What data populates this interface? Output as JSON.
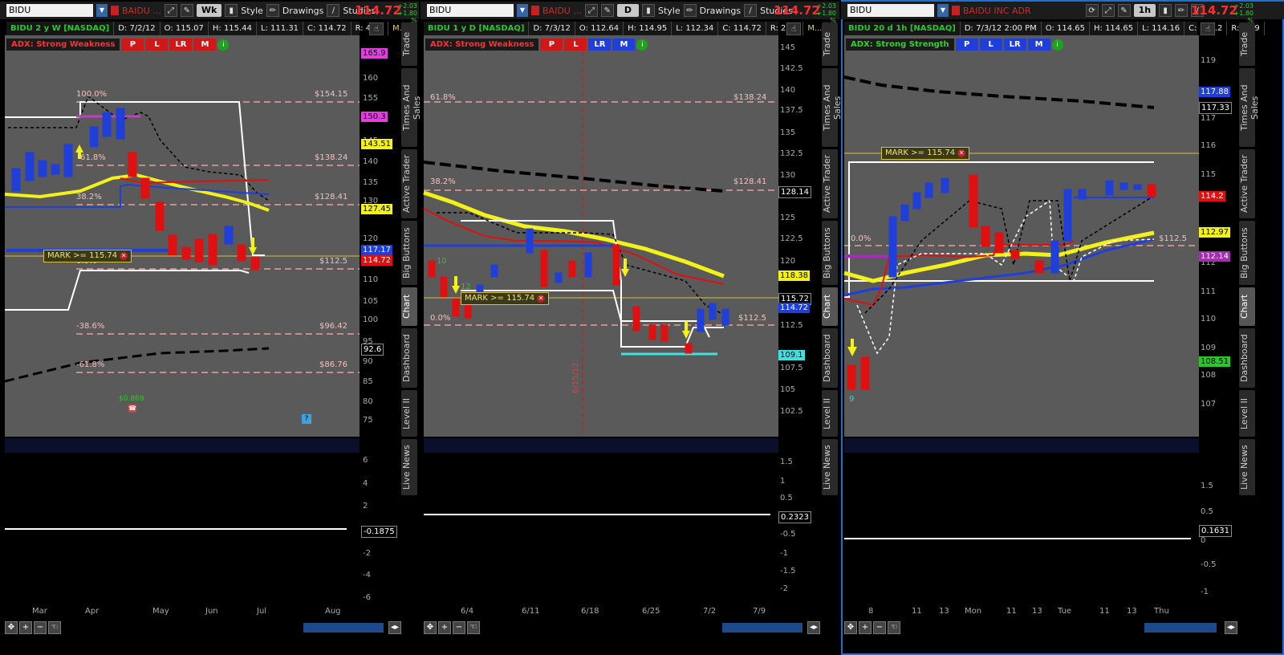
{
  "panels": [
    {
      "symbol": "BIDU",
      "company": "BAIDU ...",
      "period": "Wk",
      "style_label": "Style",
      "drawings_label": "Drawings",
      "studies_label": "Studies",
      "last_price": "114.72",
      "change": "+2.03",
      "change_pct": "+1.80 %",
      "info": [
        "BIDU 2 y W [NASDAQ]",
        "D: 7/2/12",
        "O: 115.07",
        "H: 115.44",
        "L: 111.31",
        "C: 114.72",
        "R: 4.13",
        "M..."
      ],
      "adx_label": "ADX:  Strong Weakness",
      "buttons": [
        "P",
        "L",
        "LR",
        "M"
      ],
      "x_labels": [
        "Mar",
        "Apr",
        "May",
        "Jun",
        "Jul",
        "Aug"
      ],
      "y_labels": [
        "160",
        "155",
        "150",
        "145",
        "140",
        "135",
        "130",
        "125",
        "120",
        "115",
        "110",
        "105",
        "100",
        "95",
        "90",
        "85",
        "80",
        "75"
      ],
      "price_tags": [
        "165.9",
        "150.3",
        "143.51",
        "127.45",
        "117.17",
        "114.72",
        "92.6"
      ],
      "fib_labels": [
        "100.0%",
        "61.8%",
        "38.2%",
        "0.0%",
        "-38.6%",
        "-61.8%"
      ],
      "level_labels": [
        "$154.15",
        "$138.24",
        "$128.41",
        "$112.5",
        "$96.42",
        "$86.76"
      ],
      "mark_label": "MARK >= 115.74",
      "event_label": "$0.869",
      "sub_y_labels": [
        "6",
        "4",
        "2",
        "0",
        "-2",
        "-4",
        "-6"
      ],
      "sub_value": "-0.1875"
    },
    {
      "symbol": "BIDU",
      "company": "BAIDU ...",
      "period": "D",
      "style_label": "Style",
      "drawings_label": "Drawings",
      "studies_label": "Studies",
      "last_price": "114.72",
      "change": "+2.03",
      "change_pct": "+1.80 %",
      "info": [
        "BIDU 1 y D [NASDAQ]",
        "D: 7/3/12",
        "O: 112.64",
        "H: 114.95",
        "L: 112.34",
        "C: 114.72",
        "R: 2.61",
        "M..."
      ],
      "adx_label": "ADX:  Strong Weakness",
      "buttons": [
        "P",
        "L",
        "LR",
        "M"
      ],
      "x_labels": [
        "6/4",
        "6/11",
        "6/18",
        "6/25",
        "7/2",
        "7/9"
      ],
      "y_labels": [
        "145",
        "142.5",
        "140",
        "137.5",
        "135",
        "132.5",
        "130",
        "127.5",
        "125",
        "122.5",
        "120",
        "117.5",
        "112.5",
        "110",
        "107.5",
        "105",
        "102.5"
      ],
      "price_tags": [
        "128.14",
        "118.38",
        "115.72",
        "114.72",
        "109.1"
      ],
      "fib_labels": [
        "61.8%",
        "38.2%",
        "0.0%"
      ],
      "level_labels": [
        "$138.24",
        "$128.41",
        "$112.5"
      ],
      "mark_label": "MARK >= 115.74",
      "date_marker": "6/15/12",
      "counts": [
        "10",
        "12"
      ],
      "sub_y_labels": [
        "1.5",
        "1",
        "0.5",
        "0",
        "-0.5",
        "-1",
        "-1.5",
        "-2"
      ],
      "sub_value": "0.2323"
    },
    {
      "symbol": "BIDU",
      "company": "BAIDU INC ADR",
      "period": "1h",
      "last_price": "114.72",
      "change": "+2.03",
      "change_pct": "+1.80 %",
      "info": [
        "BIDU 20 d 1h [NASDAQ]",
        "D: 7/3/12 2:00 PM",
        "O: 114.65",
        "H: 114.65",
        "L: 114.16",
        "C: 114.2",
        "R: 0.49"
      ],
      "adx_label": "ADX:  Strong Strength",
      "buttons": [
        "P",
        "L",
        "LR",
        "M"
      ],
      "x_labels": [
        "8",
        "11",
        "13",
        "Mon",
        "11",
        "13",
        "Tue",
        "11",
        "13",
        "Thu"
      ],
      "y_labels": [
        "119",
        "118",
        "117",
        "116",
        "115",
        "114",
        "113",
        "112",
        "111",
        "110",
        "109",
        "108",
        "107"
      ],
      "price_tags": [
        "117.88",
        "117.33",
        "114.2",
        "112.97",
        "112.14",
        "108.51"
      ],
      "fib_labels": [
        "0.0%"
      ],
      "level_labels": [
        "$112.5"
      ],
      "mark_label": "MARK >= 115.74",
      "counts": [
        "9"
      ],
      "sub_y_labels": [
        "1.5",
        "1",
        "0.5",
        "0",
        "-0.5",
        "-1"
      ],
      "sub_value": "0.1631"
    }
  ],
  "sidebar_tabs": [
    "Trade",
    "Times And Sales",
    "Active Trader",
    "Big Buttons",
    "Chart",
    "Dashboard",
    "Level II",
    "Live News"
  ],
  "colors": {
    "up": "#1f3fd8",
    "down": "#e01010",
    "ema_yellow": "#f2f21a",
    "plot_bg": "#5a5a5a",
    "price_red": "#ff2b2b",
    "change_green": "#2bd12b"
  }
}
